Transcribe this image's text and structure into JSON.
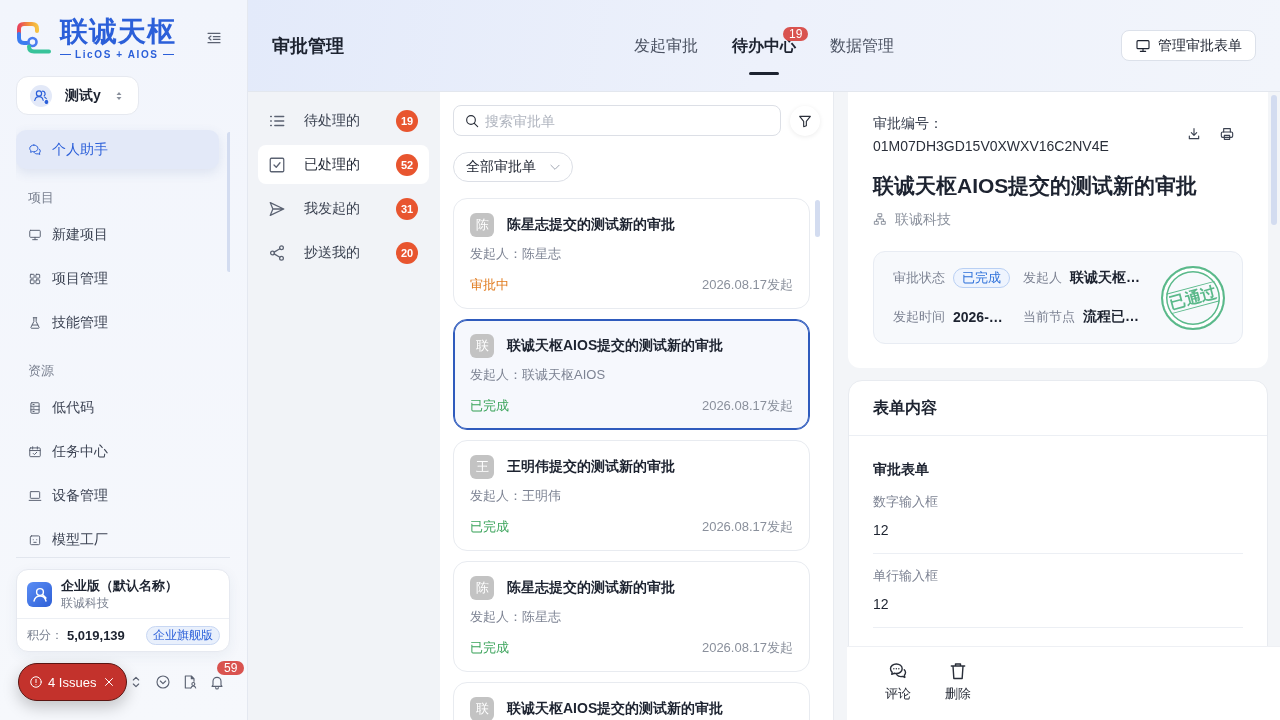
{
  "sidebar": {
    "logo": {
      "title": "联诚天枢",
      "subtitle": "LicOS + AIOS"
    },
    "workspace": {
      "name": "测试y"
    },
    "pinned": [
      {
        "label": "个人助手",
        "selected": true
      }
    ],
    "sections": [
      {
        "title": "项目",
        "items": [
          {
            "label": "新建项目",
            "selected": false
          },
          {
            "label": "项目管理",
            "selected": false
          },
          {
            "label": "技能管理",
            "selected": false
          }
        ]
      },
      {
        "title": "资源",
        "items": [
          {
            "label": "低代码",
            "selected": false
          },
          {
            "label": "任务中心",
            "selected": false
          },
          {
            "label": "设备管理",
            "selected": false
          },
          {
            "label": "模型工厂",
            "selected": false
          }
        ]
      }
    ],
    "enterprise": {
      "name": "企业版（默认名称）",
      "company": "联诚科技",
      "points_label": "积分：",
      "points": "5,019,139",
      "plan": "企业旗舰版"
    },
    "notifications": {
      "count": "59"
    }
  },
  "issues": {
    "label": "4 Issues"
  },
  "header": {
    "title": "审批管理",
    "tabs": [
      {
        "label": "发起审批",
        "selected": false
      },
      {
        "label": "待办中心",
        "selected": true,
        "badge": "19"
      },
      {
        "label": "数据管理",
        "selected": false
      }
    ],
    "action": "管理审批表单"
  },
  "filters": [
    {
      "label": "待处理的",
      "count": "19",
      "selected": false
    },
    {
      "label": "已处理的",
      "count": "52",
      "selected": true
    },
    {
      "label": "我发起的",
      "count": "31",
      "selected": false
    },
    {
      "label": "抄送我的",
      "count": "20",
      "selected": false
    }
  ],
  "list": {
    "search": {
      "placeholder": "搜索审批单"
    },
    "dropdown": "全部审批单",
    "cards": [
      {
        "avatar": "陈",
        "title": "陈星志提交的测试新的审批",
        "initiator": "发起人：陈星志",
        "status": {
          "text": "审批中",
          "kind": "pending"
        },
        "date": "2026.08.17发起",
        "selected": false
      },
      {
        "avatar": "联",
        "title": "联诚天枢AIOS提交的测试新的审批",
        "initiator": "发起人：联诚天枢AIOS",
        "status": {
          "text": "已完成",
          "kind": "done"
        },
        "date": "2026.08.17发起",
        "selected": true
      },
      {
        "avatar": "王",
        "title": "王明伟提交的测试新的审批",
        "initiator": "发起人：王明伟",
        "status": {
          "text": "已完成",
          "kind": "done"
        },
        "date": "2026.08.17发起",
        "selected": false
      },
      {
        "avatar": "陈",
        "title": "陈星志提交的测试新的审批",
        "initiator": "发起人：陈星志",
        "status": {
          "text": "已完成",
          "kind": "done"
        },
        "date": "2026.08.17发起",
        "selected": false
      },
      {
        "avatar": "联",
        "title": "联诚天枢AIOS提交的测试新的审批",
        "selected": false
      }
    ]
  },
  "detail": {
    "number_label": "审批编号：",
    "number": "01M07DH3GD15V0XWXV16C2NV4E",
    "title": "联诚天枢AIOS提交的测试新的审批",
    "org": "联诚科技",
    "info": [
      {
        "label": "审批状态",
        "value": "已完成",
        "kind": "tag"
      },
      {
        "label": "发起人",
        "value": "联诚天枢…",
        "kind": "text"
      },
      {
        "label": "发起时间",
        "value": "2026-…",
        "kind": "text"
      },
      {
        "label": "当前节点",
        "value": "流程已…",
        "kind": "text"
      }
    ],
    "stamp": "已通过",
    "form": {
      "title": "表单内容",
      "section": "审批表单",
      "fields": [
        {
          "label": "数字输入框",
          "value": "12"
        },
        {
          "label": "单行输入框",
          "value": "12"
        }
      ]
    },
    "actions": [
      {
        "label": "评论"
      },
      {
        "label": "删除"
      }
    ]
  }
}
